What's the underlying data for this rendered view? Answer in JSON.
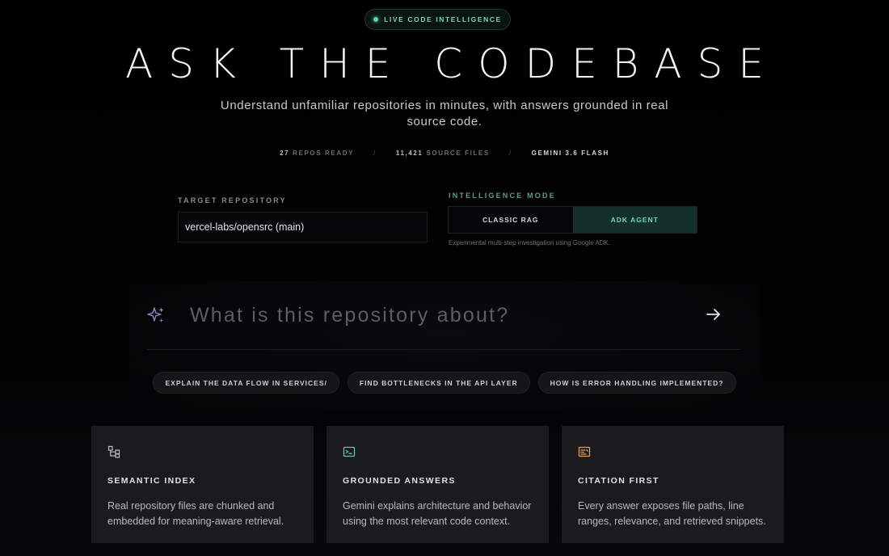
{
  "badge": {
    "label": "LIVE CODE INTELLIGENCE"
  },
  "hero": {
    "title": "ASK THE CODEBASE",
    "subtitle": "Understand unfamiliar repositories in minutes, with answers grounded in real source code."
  },
  "stats": {
    "repos_count": "27",
    "repos_label": "REPOS READY",
    "files_count": "11,421",
    "files_label": "SOURCE FILES",
    "separator": "/",
    "model": "GEMINI 3.6 FLASH"
  },
  "repository": {
    "label": "TARGET REPOSITORY",
    "value": "vercel-labs/opensrc (main)"
  },
  "mode": {
    "label": "INTELLIGENCE MODE",
    "options": [
      "CLASSIC RAG",
      "ADK AGENT"
    ],
    "selected": "ADK AGENT",
    "note": "Experimental multi-step investigation using Google ADK."
  },
  "ask": {
    "placeholder": "What is this repository about?",
    "value": ""
  },
  "suggestions": [
    "EXPLAIN THE DATA FLOW IN SERVICES/",
    "FIND BOTTLENECKS IN THE API LAYER",
    "HOW IS ERROR HANDLING IMPLEMENTED?"
  ],
  "features": [
    {
      "icon": "hierarchy-icon",
      "title": "SEMANTIC INDEX",
      "description": "Real repository files are chunked and embedded for meaning-aware retrieval."
    },
    {
      "icon": "terminal-icon",
      "title": "GROUNDED ANSWERS",
      "description": "Gemini explains architecture and behavior using the most relevant code context."
    },
    {
      "icon": "citation-icon",
      "title": "CITATION FIRST",
      "description": "Every answer exposes file paths, line ranges, relevance, and retrieved snippets."
    }
  ],
  "colors": {
    "accent": "#72d6b0",
    "accent_bg": "#15302a",
    "sparkle": "#8b86c9",
    "terminal_icon": "#5fc9a6",
    "citation_icon": "#d9a25a",
    "card_bg": "#1b1b1f"
  }
}
